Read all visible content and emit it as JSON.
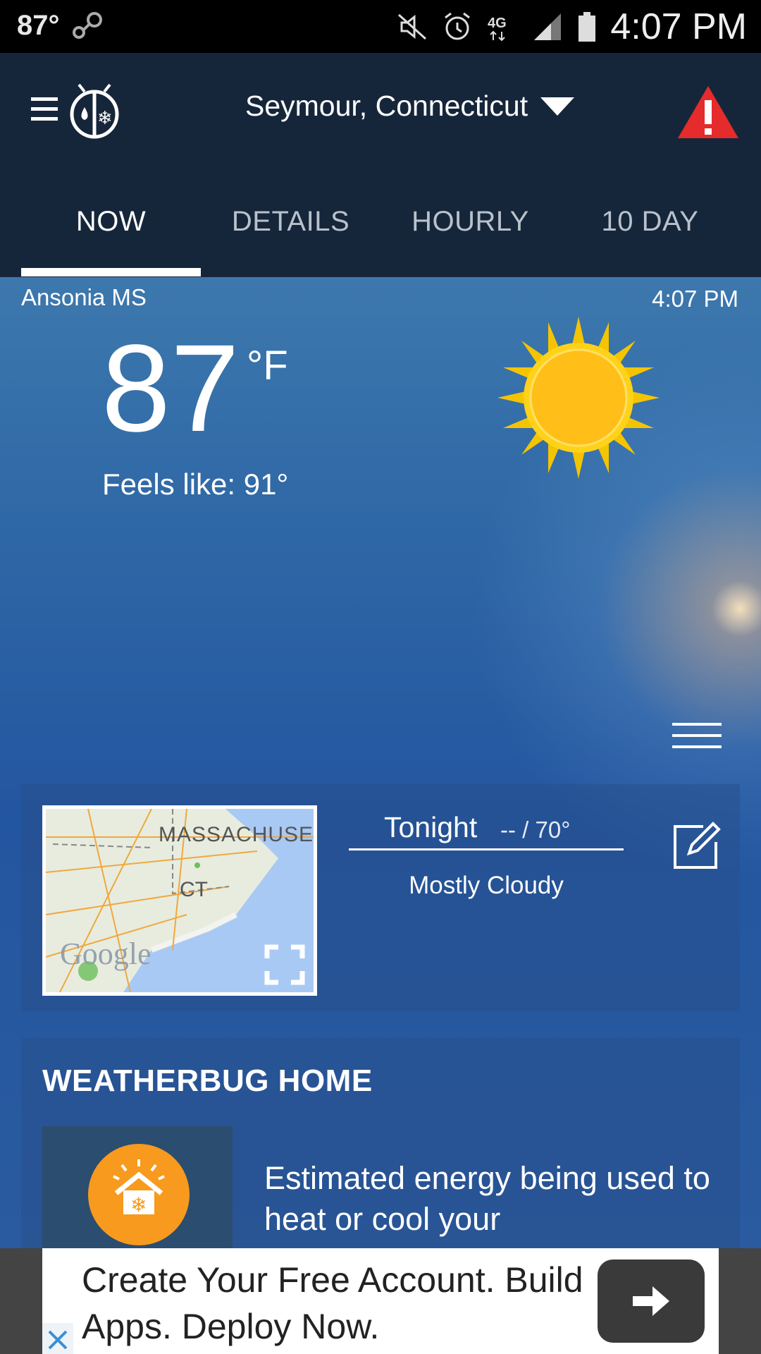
{
  "status_bar": {
    "temp": "87°",
    "time": "4:07 PM",
    "network": "4G LTE"
  },
  "app_bar": {
    "location": "Seymour, Connecticut"
  },
  "tabs": [
    {
      "label": "NOW",
      "active": true
    },
    {
      "label": "DETAILS",
      "active": false
    },
    {
      "label": "HOURLY",
      "active": false
    },
    {
      "label": "10 DAY",
      "active": false
    }
  ],
  "current": {
    "station": "Ansonia MS",
    "obs_time": "4:07 PM",
    "temperature": "87",
    "unit": "°F",
    "feels_like": "Feels like: 91°"
  },
  "forecast_card": {
    "map": {
      "label_state_1": "MASSACHUSET",
      "label_state_2": "CT",
      "attribution": "Google"
    },
    "period": "Tonight",
    "temps": "-- / 70°",
    "condition": "Mostly Cloudy"
  },
  "home_card": {
    "title": "WEATHERBUG HOME",
    "text": "Estimated energy being used to heat or cool your"
  },
  "ad": {
    "text": "Create Your Free Account. Build Apps. Deploy Now."
  },
  "colors": {
    "app_bar": "#16263a",
    "sky_top": "#3d78ad",
    "sky_bottom": "#2356a0",
    "alert_red": "#e52b2b",
    "home_orange": "#f79a1e"
  }
}
